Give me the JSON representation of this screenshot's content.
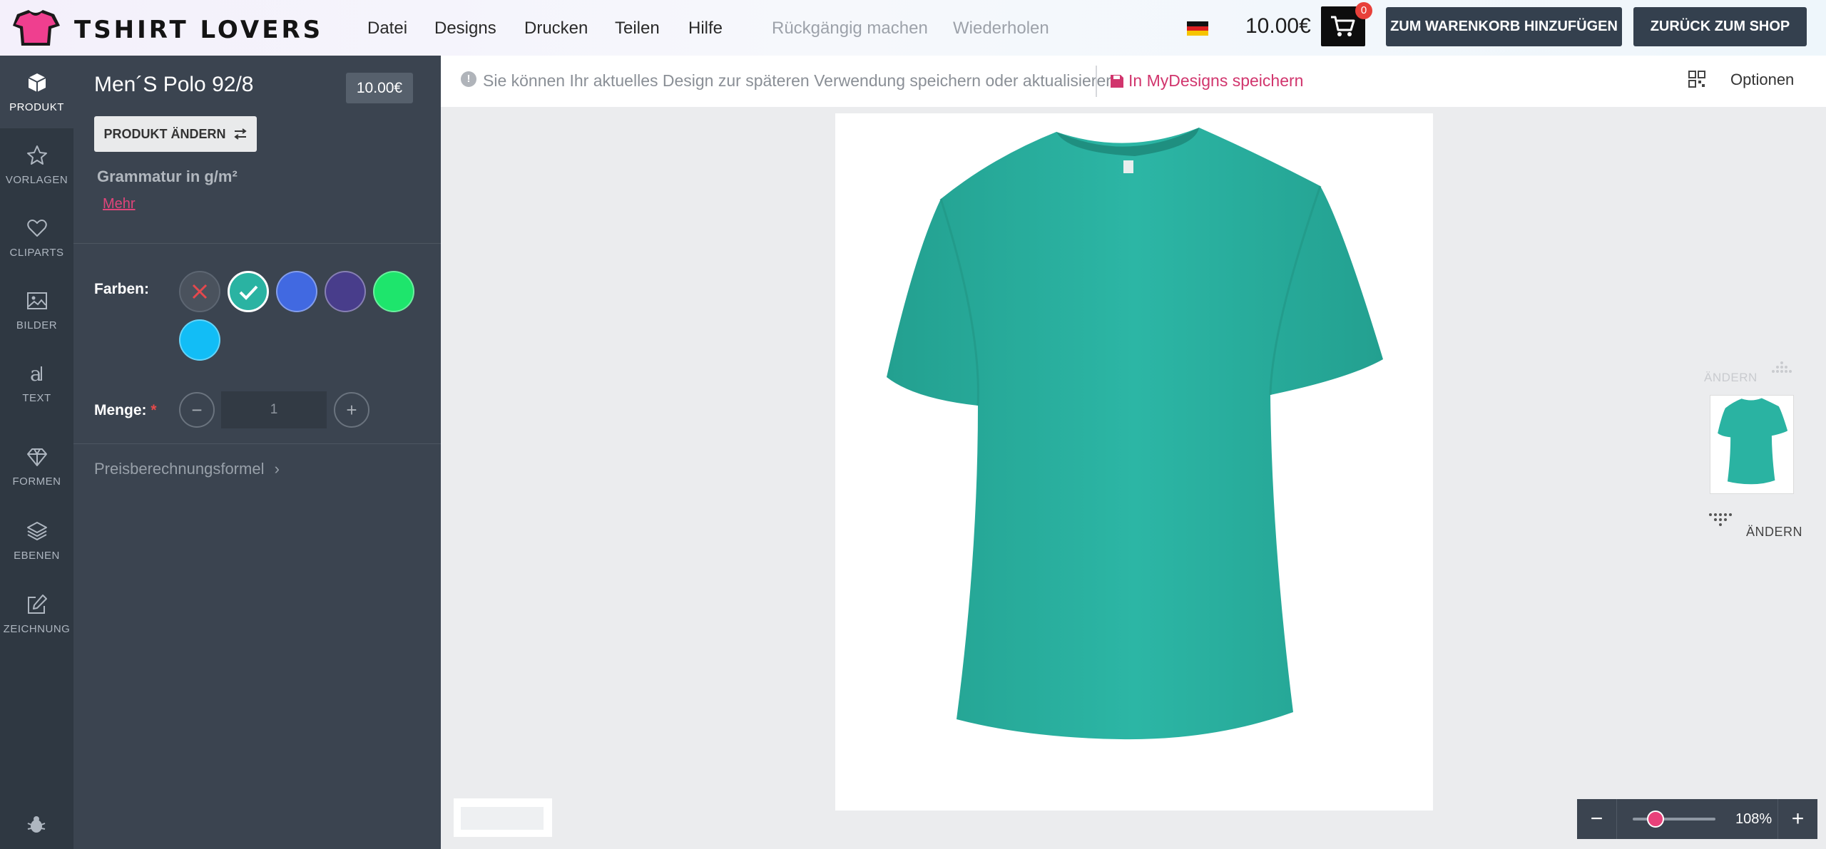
{
  "header": {
    "brand": "TSHIRT LOVERS",
    "menu": [
      "Datei",
      "Designs",
      "Drucken",
      "Teilen",
      "Hilfe"
    ],
    "undo": "Rückgängig machen",
    "redo": "Wiederholen",
    "language_flag": "flag-de-icon",
    "total_price": "10.00€",
    "cart_count": "0",
    "add_to_cart": "ZUM WARENKORB HINZUFÜGEN",
    "back_to_shop": "ZURÜCK ZUM SHOP"
  },
  "sidebar": {
    "items": [
      {
        "label": "PRODUKT",
        "icon": "cube-icon",
        "active": true
      },
      {
        "label": "VORLAGEN",
        "icon": "star-icon"
      },
      {
        "label": "CLIPARTS",
        "icon": "heart-icon"
      },
      {
        "label": "BILDER",
        "icon": "image-icon"
      },
      {
        "label": "TEXT",
        "icon": "text-icon"
      },
      {
        "label": "FORMEN",
        "icon": "diamond-icon"
      },
      {
        "label": "EBENEN",
        "icon": "layers-icon"
      },
      {
        "label": "ZEICHNUNG",
        "icon": "edit-icon"
      }
    ]
  },
  "product": {
    "name": "Men´S Polo 92/8",
    "price": "10.00€",
    "change_button": "PRODUKT ÄNDERN",
    "grammage": "Grammatur in g/m²",
    "more_link": "Mehr",
    "colors_label": "Farben:",
    "colors": [
      "#4a525d",
      "#2ab3a2",
      "#4169e1",
      "#483d8b",
      "#1ee56c",
      "#12bdf6"
    ],
    "selected_color": "#2ab3a2",
    "quantity_label": "Menge:",
    "quantity_required_mark": "*",
    "quantity": "1",
    "price_formula": "Preisberechnungsformel"
  },
  "infobar": {
    "message": "Sie können Ihr aktuelles Design zur späteren Verwendung speichern oder aktualisieren",
    "save_link": "In MyDesigns speichern",
    "options": "Optionen"
  },
  "views": {
    "change_top": "ÄNDERN",
    "change_bottom": "ÄNDERN"
  },
  "zoom": {
    "value": "108%",
    "level": 0.27
  },
  "colors": {
    "accent": "#e8417a",
    "panel": "#3b4450",
    "nav": "#2f3842",
    "shirt": "#2ab3a2"
  }
}
